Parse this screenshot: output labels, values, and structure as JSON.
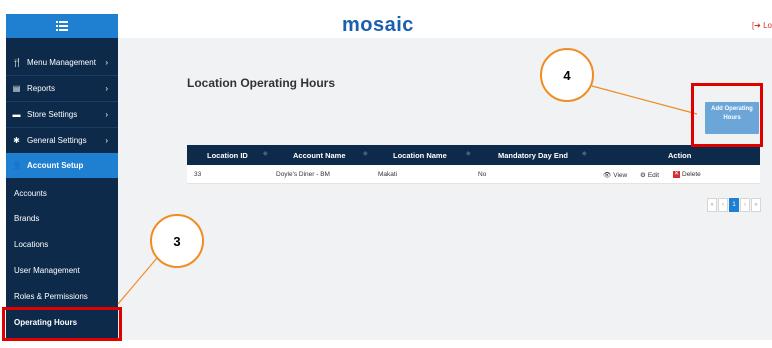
{
  "brand": {
    "logo_text": "mosaic",
    "logout_text": "[➜ Lo"
  },
  "sidebar": {
    "menu_icon": "hamburger-icon",
    "items": [
      {
        "label": "Menu Management",
        "icon": "fork-knife-icon"
      },
      {
        "label": "Reports",
        "icon": "file-icon"
      },
      {
        "label": "Store Settings",
        "icon": "store-icon"
      },
      {
        "label": "General Settings",
        "icon": "gear-icon"
      },
      {
        "label": "Account Setup",
        "icon": "user-icon"
      }
    ],
    "subitems": [
      {
        "label": "Accounts"
      },
      {
        "label": "Brands"
      },
      {
        "label": "Locations"
      },
      {
        "label": "User Management"
      },
      {
        "label": "Roles & Permissions"
      },
      {
        "label": "Operating Hours"
      }
    ]
  },
  "main": {
    "title": "Location Operating Hours",
    "add_button_label": "Add Operating Hours",
    "table": {
      "columns": [
        "Location ID",
        "Account Name",
        "Location Name",
        "Mandatory Day End",
        "Action"
      ],
      "rows": [
        {
          "location_id": "33",
          "account_name": "Doyle's Diner - BM",
          "location_name": "Makati",
          "mandatory_day_end": "No"
        }
      ],
      "actions": {
        "view": "View",
        "edit": "Edit",
        "delete": "Delete"
      }
    },
    "pagination": {
      "first": "«",
      "prev": "‹",
      "current": "1",
      "next": "›",
      "last": "»"
    }
  },
  "annotations": {
    "callout_3": "3",
    "callout_4": "4"
  },
  "colors": {
    "sidebar_bg": "#0d2a4a",
    "accent": "#1f7fd1",
    "callout": "#f08c24",
    "highlight": "#e10000"
  }
}
